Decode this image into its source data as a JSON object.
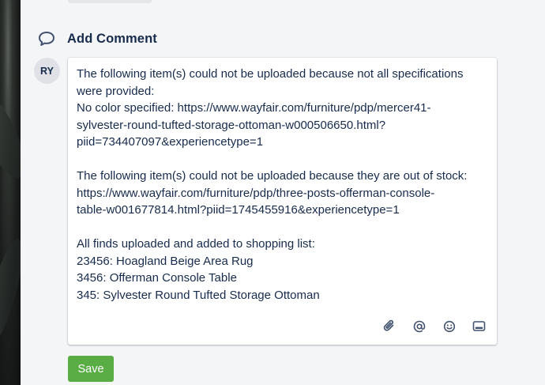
{
  "section": {
    "title": "Add Comment",
    "icon": "comment-icon"
  },
  "user": {
    "initials": "RY"
  },
  "comment": {
    "lines": [
      "The following item(s) could not be uploaded because not all specifications",
      "were provided:",
      "No color specified: https://www.wayfair.com/furniture/pdp/mercer41-",
      "sylvester-round-tufted-storage-ottoman-w000506650.html?",
      "piid=734407097&experiencetype=1",
      "",
      "The following item(s) could not be uploaded because they are out of stock:",
      "https://www.wayfair.com/furniture/pdp/three-posts-offerman-console-",
      "table-w001677814.html?piid=1745455916&experiencetype=1",
      "",
      "All finds uploaded and added to shopping list:",
      "23456: Hoagland Beige Area Rug",
      "3456: Offerman Console Table",
      "345: Sylvester Round Tufted Storage Ottoman"
    ]
  },
  "toolbar": {
    "icons": [
      "attachment-icon",
      "mention-icon",
      "emoji-icon",
      "card-icon"
    ]
  },
  "actions": {
    "save_label": "Save"
  },
  "colors": {
    "save_button": "#5aac44",
    "text": "#172b4d",
    "avatar_bg": "#dfe1e6"
  }
}
